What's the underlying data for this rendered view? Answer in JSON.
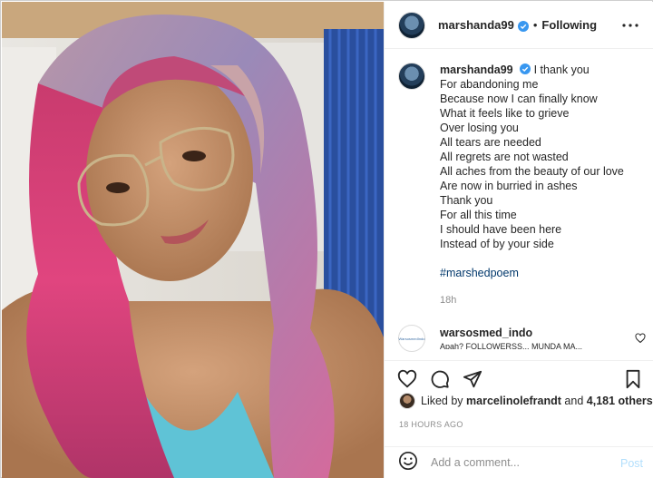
{
  "post": {
    "username": "marshanda99",
    "follow_state": "Following",
    "separator": "•"
  },
  "caption": {
    "username": "marshanda99",
    "lines": [
      "I thank you",
      "For abandoning me",
      "Because now I can finally know",
      "What it feels like to grieve",
      "Over losing you",
      "All tears are needed",
      "All regrets are not wasted",
      "All aches from the beauty of our love",
      "Are now in burried in ashes",
      "Thank you",
      "For all this time",
      "I should have been here",
      "Instead of by your side"
    ],
    "hashtag": "#marshedpoem",
    "age": "18h"
  },
  "comment": {
    "username": "warsosmed_indo",
    "text": "Apah? FOLLOWERSS... MUNDA MA...",
    "avatar_text": "WarsosmedIndo"
  },
  "likes": {
    "prefix": "Liked by",
    "user": "marcelinolefrandt",
    "connector": "and",
    "others": "4,181 others"
  },
  "timestamp": "18 HOURS AGO",
  "add_comment": {
    "placeholder": "Add a comment...",
    "post_label": "Post"
  },
  "colors": {
    "verified": "#3897f0",
    "link": "#00376b",
    "muted": "#8e8e8e",
    "post_disabled": "#b2dffc"
  },
  "icons": {
    "more": "more-horizontal-icon",
    "like": "heart-icon",
    "comment": "comment-bubble-icon",
    "share": "paper-plane-icon",
    "save": "bookmark-icon",
    "emoji": "smiley-icon",
    "verified": "verified-badge-icon"
  }
}
